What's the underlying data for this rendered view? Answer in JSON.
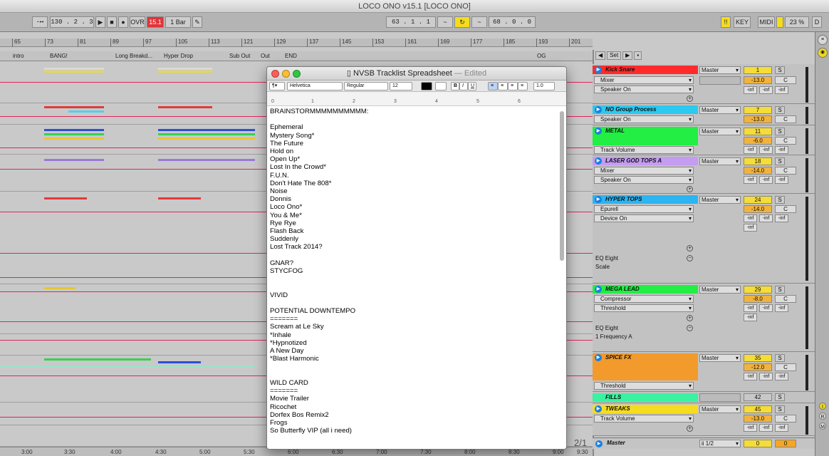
{
  "app": {
    "title": "LOCO ONO v15.1  [LOCO ONO]"
  },
  "toolbar": {
    "follow": "-↦",
    "position": "130 .  2 .  3",
    "play": "▶",
    "stop": "■",
    "record": "●",
    "ovr": "OVR",
    "quantize_count": "15.1",
    "quantize": "1 Bar",
    "pencil": "✎",
    "loop_start": "63 .  1 .  1",
    "loop_len": "68 .  0 .  0",
    "key": "KEY",
    "midi": "MIDI",
    "cpu": "23 %",
    "d": "D"
  },
  "ruler": {
    "ticks": [
      "65",
      "73",
      "81",
      "89",
      "97",
      "105",
      "113",
      "121",
      "129",
      "137",
      "145",
      "153",
      "161",
      "169",
      "177",
      "185",
      "193",
      "201"
    ]
  },
  "locators": [
    "intro",
    "BANG!",
    "Long Breakd...",
    "Hyper Drop",
    "Sub Out",
    "Out",
    "END",
    "OG"
  ],
  "timeline": [
    "3:00",
    "3:30",
    "4:00",
    "4:30",
    "5:00",
    "5:30",
    "6:00",
    "6:30",
    "7:00",
    "7:30",
    "8:00",
    "8:30",
    "9:00",
    "9:30"
  ],
  "set_bar": {
    "set": "Set"
  },
  "tracks": [
    {
      "name": "Kick Snare",
      "color": "#ff2b2b",
      "dev": "Mixer",
      "param": "Speaker On",
      "route": "Master",
      "num": "1",
      "vol": "-13.0",
      "pan": "C"
    },
    {
      "name": "NO Group Process",
      "color": "#2cc9f0",
      "param": "Speaker On",
      "route": "Master",
      "num": "7",
      "vol": "-13.0",
      "pan": "C"
    },
    {
      "name": "METAL",
      "color": "#22ee44",
      "param": "Track Volume",
      "route": "Master",
      "num": "11",
      "vol": "-6.0",
      "pan": "C"
    },
    {
      "name": "LASER GOD TOPS A",
      "color": "#c49cf2",
      "dev": "Mixer",
      "param": "Speaker On",
      "route": "Master",
      "num": "18",
      "vol": "-14.0",
      "pan": "C"
    },
    {
      "name": "HYPER TOPS",
      "color": "#2cb4f3",
      "dev": "Epurell",
      "param": "Device On",
      "route": "Master",
      "num": "24",
      "vol": "-14.0",
      "pan": "C",
      "eq": "EQ Eight",
      "eq2": "Scale"
    },
    {
      "name": "MEGA LEAD",
      "color": "#22ee44",
      "dev": "Compressor",
      "param": "Threshold",
      "route": "Master",
      "num": "29",
      "vol": "-8.0",
      "pan": "C",
      "eq": "EQ Eight",
      "eq2": "1 Frequency A"
    },
    {
      "name": "SPICE FX",
      "color": "#f29a2c",
      "param": "Threshold",
      "route": "Master",
      "num": "35",
      "vol": "-12.0",
      "pan": "C"
    },
    {
      "name": "FILLS",
      "color": "#3af2a0",
      "num": "42"
    },
    {
      "name": "TWEAKS",
      "color": "#f6dc1e",
      "param": "Track Volume",
      "route": "Master",
      "num": "45",
      "vol": "-13.0",
      "pan": "C"
    }
  ],
  "master": {
    "name": "Master",
    "route": "ii 1/2",
    "num": "0",
    "vol": "0"
  },
  "misc": {
    "scene": "2/1"
  },
  "inf": "-inf",
  "doc": {
    "title": "NVSB Tracklist Spreadsheet",
    "status": "— Edited",
    "style_menu": "¶▾",
    "font": "Helvetica",
    "weight": "Regular",
    "size": "12",
    "spacing": "1.0",
    "bold": "B",
    "italic": "I",
    "underline": "U",
    "ruler": [
      "0",
      "1",
      "2",
      "3",
      "4",
      "5",
      "6"
    ],
    "text": "BRAINSTORMMMMMMMMMM:\n\nEphemeral\nMystery Song*\nThe Future\nHold on\nOpen Up*\nLost In the Crowd*\nF.U.N.\nDon't Hate The 808*\nNoise\nDonnis\nLoco Ono*\nYou & Me*\nRye Rye\nFlash Back\nSuddenly\nLost Track 2014?\n\nGNAR?\nSTYCFOG\n\n\nVIVID\n\nPOTENTIAL DOWNTEMPO\n=======\nScream at Le Sky\n*Inhale\n*Hypnotized\nA New Day\n*Blast Harmonic\n\n\nWILD CARD\n=======\nMovie Trailer\nRicochet\nDorfex Bos Remix2\nFrogs\nSo Butterfly VIP (all i need)"
  }
}
